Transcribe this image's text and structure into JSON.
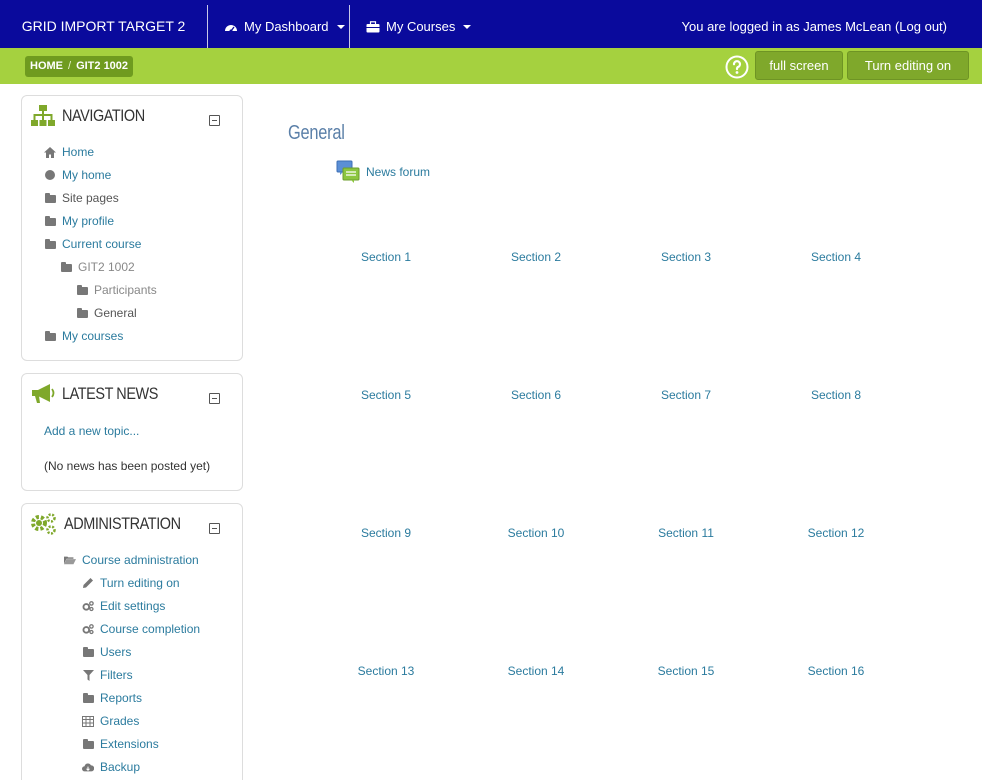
{
  "navbar": {
    "brand": "GRID IMPORT TARGET 2",
    "menu_dashboard": "My Dashboard",
    "menu_courses": "My Courses",
    "login_text": "You are logged in as James McLean (Log out)"
  },
  "breadcrumb": {
    "home": "HOME",
    "separator": "/",
    "course": "GIT2 1002"
  },
  "buttons": {
    "full_screen": "full screen",
    "turn_editing_on": "Turn editing on"
  },
  "navigation": {
    "title": "NAVIGATION",
    "items": [
      {
        "label": "Home",
        "icon": "home-icon"
      },
      {
        "label": "My home",
        "icon": "circle-icon"
      },
      {
        "label": "Site pages",
        "icon": "folder-icon"
      },
      {
        "label": "My profile",
        "icon": "folder-icon"
      },
      {
        "label": "Current course",
        "icon": "folder-icon"
      },
      {
        "label": "GIT2 1002",
        "icon": "folder-icon"
      },
      {
        "label": "Participants",
        "icon": "folder-icon"
      },
      {
        "label": "General",
        "icon": "folder-icon"
      },
      {
        "label": "My courses",
        "icon": "folder-icon"
      }
    ]
  },
  "latest_news": {
    "title": "LATEST NEWS",
    "add_topic": "Add a new topic...",
    "empty": "(No news has been posted yet)"
  },
  "administration": {
    "title": "ADMINISTRATION",
    "items": [
      {
        "label": "Course administration",
        "icon": "folder-open-icon"
      },
      {
        "label": "Turn editing on",
        "icon": "pencil-icon"
      },
      {
        "label": "Edit settings",
        "icon": "gears-icon"
      },
      {
        "label": "Course completion",
        "icon": "gears-icon"
      },
      {
        "label": "Users",
        "icon": "folder-icon"
      },
      {
        "label": "Filters",
        "icon": "filter-icon"
      },
      {
        "label": "Reports",
        "icon": "folder-icon"
      },
      {
        "label": "Grades",
        "icon": "table-icon"
      },
      {
        "label": "Extensions",
        "icon": "folder-icon"
      },
      {
        "label": "Backup",
        "icon": "cloud-download-icon"
      }
    ]
  },
  "main": {
    "title": "General",
    "news_forum": "News forum",
    "sections": [
      "Section 1",
      "Section 2",
      "Section 3",
      "Section 4",
      "Section 5",
      "Section 6",
      "Section 7",
      "Section 8",
      "Section 9",
      "Section 10",
      "Section 11",
      "Section 12",
      "Section 13",
      "Section 14",
      "Section 15",
      "Section 16"
    ]
  },
  "colors": {
    "navbar": "#0a0a9c",
    "greenbar": "#a5d13f",
    "button": "#7fa82b",
    "link": "#2b7b9e",
    "title": "#5a7fa8"
  }
}
